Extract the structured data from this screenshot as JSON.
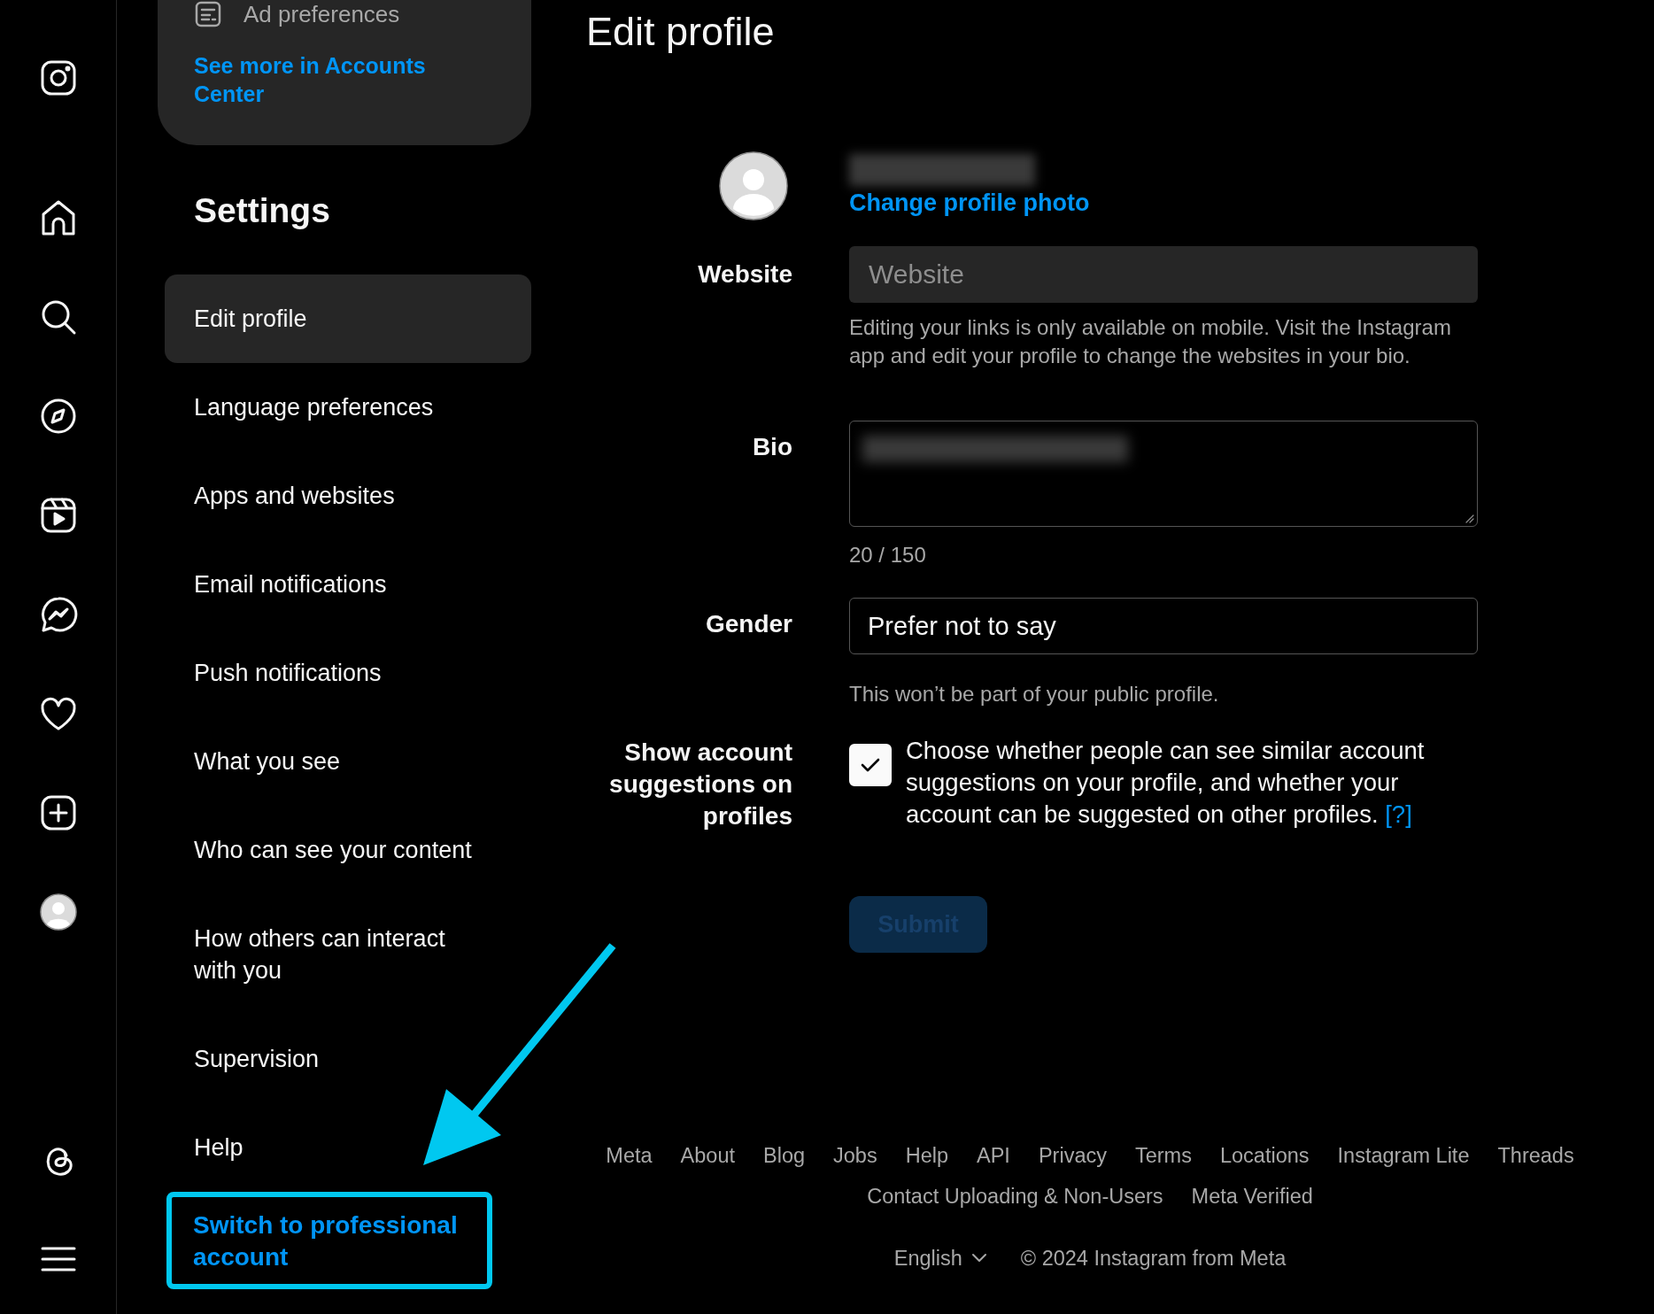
{
  "settings": {
    "accounts_card": {
      "item": "Ad preferences",
      "link": "See more in Accounts Center"
    },
    "title": "Settings",
    "items": [
      {
        "label": "Edit profile",
        "selected": true
      },
      {
        "label": "Language preferences",
        "selected": false
      },
      {
        "label": "Apps and websites",
        "selected": false
      },
      {
        "label": "Email notifications",
        "selected": false
      },
      {
        "label": "Push notifications",
        "selected": false
      },
      {
        "label": "What you see",
        "selected": false
      },
      {
        "label": "Who can see your content",
        "selected": false
      },
      {
        "label": "How others can interact with you",
        "selected": false
      },
      {
        "label": "Supervision",
        "selected": false
      },
      {
        "label": "Help",
        "selected": false
      }
    ],
    "professional_link": {
      "label": "Switch to professional account",
      "highlighted": true
    }
  },
  "main": {
    "title": "Edit profile",
    "profile": {
      "change_photo": "Change profile photo"
    },
    "website": {
      "label": "Website",
      "placeholder": "Website",
      "help": "Editing your links is only available on mobile. Visit the Instagram app and edit your profile to change the websites in your bio."
    },
    "bio": {
      "label": "Bio",
      "counter": "20 / 150"
    },
    "gender": {
      "label": "Gender",
      "value": "Prefer not to say",
      "note": "This won’t be part of your public profile."
    },
    "suggestions": {
      "label": "Show account suggestions on profiles",
      "checked": true,
      "text": "Choose whether people can see similar account suggestions on your profile, and whether your account can be suggested on other profiles.",
      "help_link": "[?]"
    },
    "submit": {
      "label": "Submit",
      "disabled": true
    }
  },
  "footer": {
    "link_rows": [
      [
        "Meta",
        "About",
        "Blog",
        "Jobs",
        "Help",
        "API",
        "Privacy",
        "Terms",
        "Locations",
        "Instagram Lite",
        "Threads"
      ],
      [
        "Contact Uploading & Non-Users",
        "Meta Verified"
      ]
    ],
    "language": "English",
    "copyright": "© 2024 Instagram from Meta"
  }
}
